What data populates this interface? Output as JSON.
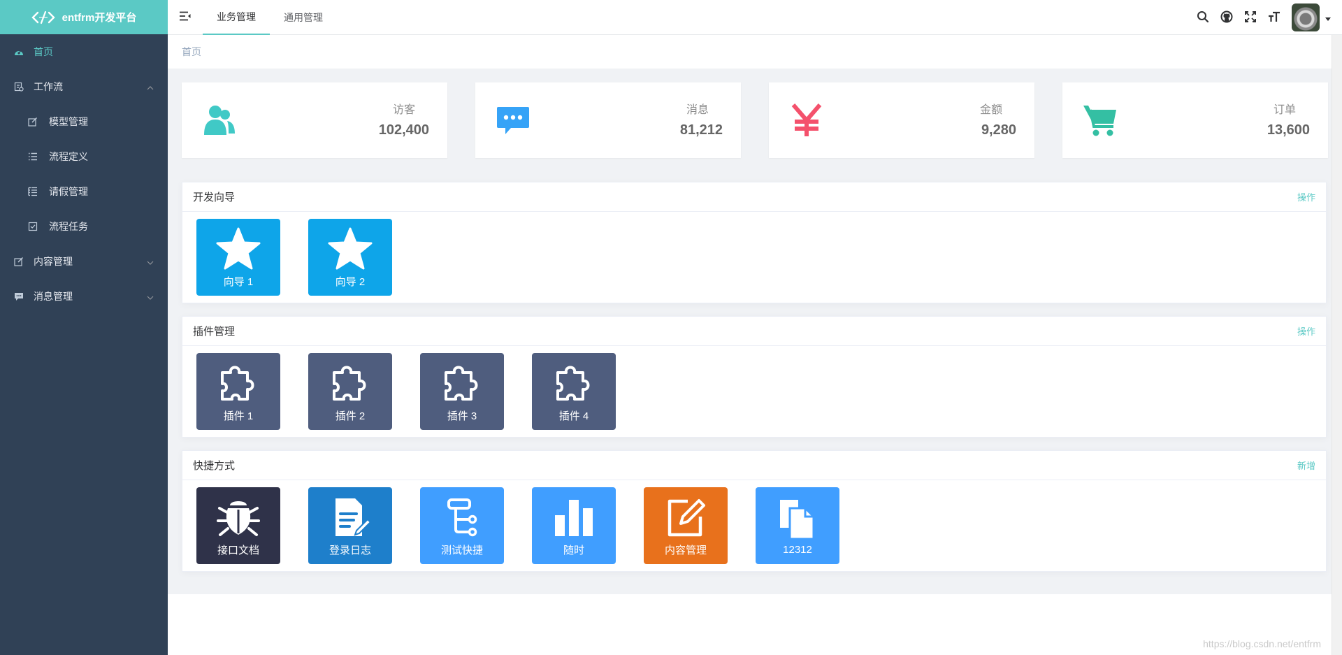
{
  "app": {
    "title": "entfrm开发平台"
  },
  "sidebar": {
    "items": [
      {
        "label": "首页",
        "icon": "dashboard-icon",
        "active": true
      },
      {
        "label": "工作流",
        "icon": "workflow-icon",
        "expanded": true,
        "children": [
          {
            "label": "模型管理",
            "icon": "edit-icon"
          },
          {
            "label": "流程定义",
            "icon": "list-icon"
          },
          {
            "label": "请假管理",
            "icon": "tree-table-icon"
          },
          {
            "label": "流程任务",
            "icon": "checkbox-icon"
          }
        ]
      },
      {
        "label": "内容管理",
        "icon": "edit-icon",
        "expanded": false
      },
      {
        "label": "消息管理",
        "icon": "message-icon",
        "expanded": false
      }
    ]
  },
  "header": {
    "tabs": [
      {
        "label": "业务管理",
        "active": true
      },
      {
        "label": "通用管理",
        "active": false
      }
    ],
    "icons": [
      "search-icon",
      "github-icon",
      "fullscreen-icon",
      "font-size-icon"
    ]
  },
  "breadcrumb": {
    "current": "首页"
  },
  "stats": [
    {
      "label": "访客",
      "value": "102,400",
      "icon": "people-icon",
      "color": "#40c9c6"
    },
    {
      "label": "消息",
      "value": "81,212",
      "icon": "message-icon",
      "color": "#36a3f7"
    },
    {
      "label": "金额",
      "value": "9,280",
      "icon": "yuan-icon",
      "color": "#f4516c"
    },
    {
      "label": "订单",
      "value": "13,600",
      "icon": "shopping-cart-icon",
      "color": "#34bfa3"
    }
  ],
  "panels": {
    "guide": {
      "title": "开发向导",
      "action": "操作",
      "tiles": [
        {
          "label": "向导 1",
          "icon": "star-icon",
          "color": "#0ea5e9"
        },
        {
          "label": "向导 2",
          "icon": "star-icon",
          "color": "#0ea5e9"
        }
      ]
    },
    "plugins": {
      "title": "插件管理",
      "action": "操作",
      "tiles": [
        {
          "label": "插件 1",
          "icon": "puzzle-icon",
          "color": "#4f5d7e"
        },
        {
          "label": "插件 2",
          "icon": "puzzle-icon",
          "color": "#4f5d7e"
        },
        {
          "label": "插件 3",
          "icon": "puzzle-icon",
          "color": "#4f5d7e"
        },
        {
          "label": "插件 4",
          "icon": "puzzle-icon",
          "color": "#4f5d7e"
        }
      ]
    },
    "shortcuts": {
      "title": "快捷方式",
      "action": "新增",
      "tiles": [
        {
          "label": "接口文档",
          "icon": "bug-icon",
          "color": "#2f3249"
        },
        {
          "label": "登录日志",
          "icon": "document-edit-icon",
          "color": "#1e7fcb"
        },
        {
          "label": "测试快捷",
          "icon": "tree-icon",
          "color": "#409eff"
        },
        {
          "label": "随时",
          "icon": "bar-chart-icon",
          "color": "#409eff"
        },
        {
          "label": "内容管理",
          "icon": "edit-icon",
          "color": "#e8711c"
        },
        {
          "label": "12312",
          "icon": "copy-icon",
          "color": "#409eff"
        }
      ]
    }
  },
  "watermark": "https://blog.csdn.net/entfrm"
}
